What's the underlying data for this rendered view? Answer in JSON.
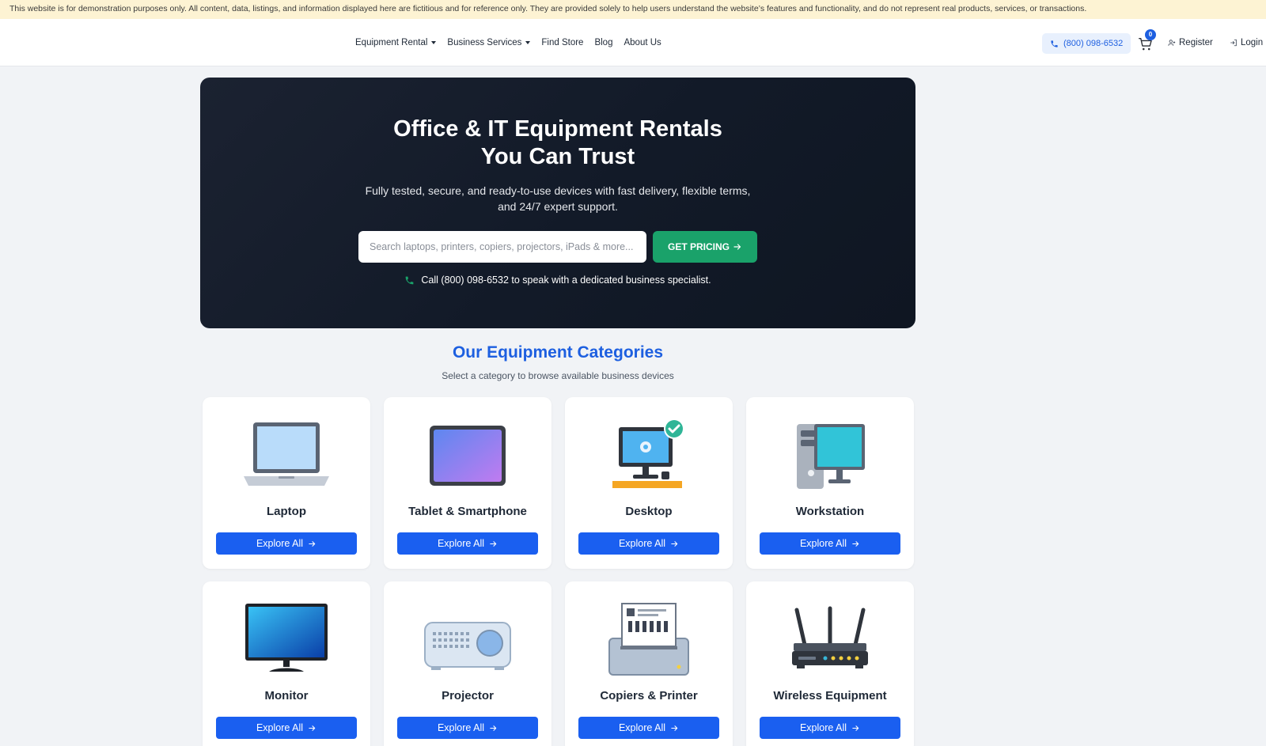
{
  "notice": {
    "text": "This website is for demonstration purposes only. All content, data, listings, and information displayed here are fictitious and for reference only. They are provided solely to help users understand the website’s features and functionality, and do not represent real products, services, or transactions."
  },
  "nav": {
    "items": [
      {
        "label": "Equipment Rental",
        "dropdown": true
      },
      {
        "label": "Business Services",
        "dropdown": true
      },
      {
        "label": "Find Store",
        "dropdown": false
      },
      {
        "label": "Blog",
        "dropdown": false
      },
      {
        "label": "About Us",
        "dropdown": false
      }
    ],
    "phone": "(800) 098-6532",
    "cart_count": "0",
    "register": "Register",
    "login": "Login"
  },
  "hero": {
    "title_line1": "Office & IT Equipment Rentals",
    "title_line2": "You Can Trust",
    "subtitle_line1": "Fully tested, secure, and ready-to-use devices with fast delivery, flexible terms,",
    "subtitle_line2": "and 24/7 expert support.",
    "search_placeholder": "Search laptops, printers, copiers, projectors, iPads & more...",
    "cta": "GET PRICING",
    "call_text": "Call (800) 098-6532 to speak with a dedicated business specialist."
  },
  "categories": {
    "title": "Our Equipment Categories",
    "subtitle": "Select a category to browse available business devices",
    "button_label": "Explore All",
    "items": [
      {
        "name": "Laptop",
        "icon": "laptop-icon"
      },
      {
        "name": "Tablet & Smartphone",
        "icon": "tablet-icon"
      },
      {
        "name": "Desktop",
        "icon": "desktop-icon"
      },
      {
        "name": "Workstation",
        "icon": "workstation-icon"
      },
      {
        "name": "Monitor",
        "icon": "monitor-icon"
      },
      {
        "name": "Projector",
        "icon": "projector-icon"
      },
      {
        "name": "Copiers & Printer",
        "icon": "printer-icon"
      },
      {
        "name": "Wireless Equipment",
        "icon": "router-icon"
      }
    ]
  },
  "colors": {
    "primary": "#1a5ff0",
    "accent_green": "#1aa26a",
    "hero_bg": "#151c2a",
    "notice_bg": "#fdf3d3"
  }
}
